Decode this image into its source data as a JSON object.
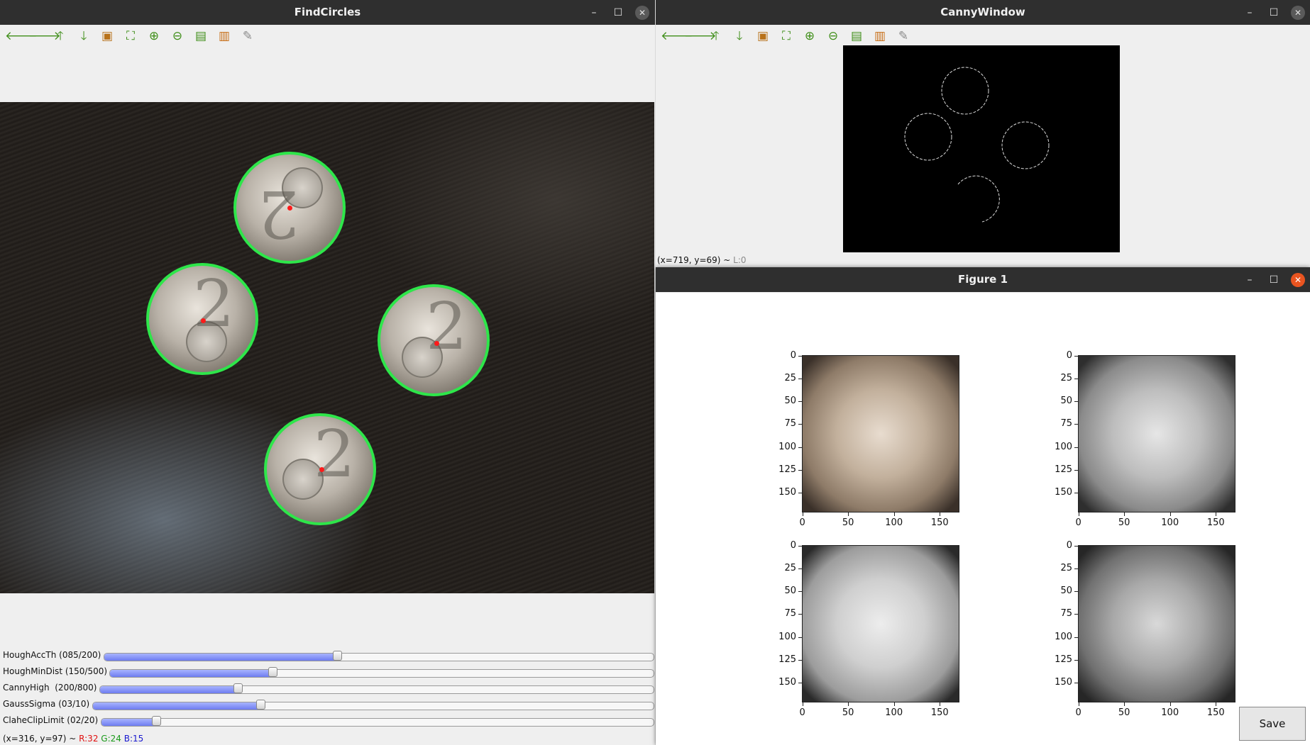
{
  "find_circles": {
    "title": "FindCircles",
    "controls": {
      "minimize": "–",
      "maximize": "☐",
      "close": "✕"
    },
    "toolbar": [
      "arrow-left-icon",
      "arrow-right-icon",
      "arrow-up-icon",
      "arrow-down-icon",
      "image-icon",
      "fit-icon",
      "zoom-in-icon",
      "zoom-out-icon",
      "save-icon",
      "clipboard-icon",
      "brush-icon"
    ],
    "sliders": [
      {
        "label": "HoughAccTh (085/200)",
        "fraction": 0.425
      },
      {
        "label": "HoughMinDist (150/500)",
        "fraction": 0.3
      },
      {
        "label": "CannyHigh  (200/800)",
        "fraction": 0.25
      },
      {
        "label": "GaussSigma (03/10)",
        "fraction": 0.3
      },
      {
        "label": "ClaheClipLimit (02/20)",
        "fraction": 0.1
      }
    ],
    "status": {
      "coords": "(x=316, y=97) ~ ",
      "r": "R:32",
      "g": "G:24",
      "b": "B:15"
    }
  },
  "canny": {
    "title": "CannyWindow",
    "controls": {
      "minimize": "–",
      "maximize": "☐",
      "close": "✕"
    },
    "status_coords": "(x=719, y=69) ~ ",
    "status_level": "L:0"
  },
  "figure": {
    "title": "Figure 1",
    "controls": {
      "minimize": "–",
      "maximize": "☐",
      "close": "✕"
    },
    "y_ticks": [
      "0",
      "25",
      "50",
      "75",
      "100",
      "125",
      "150"
    ],
    "x_ticks": [
      "0",
      "50",
      "100",
      "150"
    ],
    "save_label": "Save"
  },
  "colors": {
    "circle": "#2ee64a",
    "center": "#ff1a1a",
    "title_bar": "#2f2f2f",
    "close_active": "#e95420",
    "toolbar_icon": "#3f8e19"
  }
}
